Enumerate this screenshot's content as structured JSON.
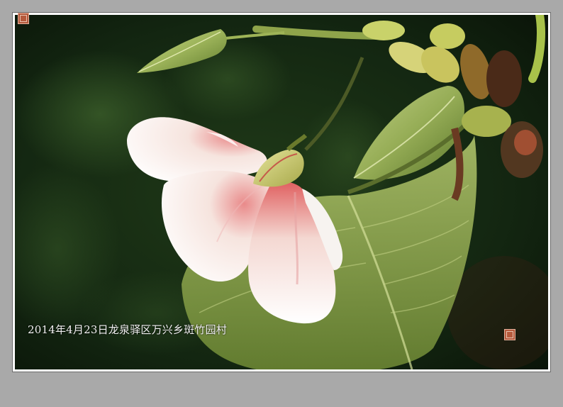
{
  "photo": {
    "caption": "2014年4月23日龙泉驿区万兴乡斑竹园村",
    "subject_icon": "white-pink-flower"
  },
  "seals": [
    {
      "name": "seal-top-left",
      "color": "#b55a3c"
    },
    {
      "name": "seal-bottom-right",
      "color": "#b55a3c"
    }
  ],
  "colors": {
    "background": "#a9a9a9",
    "border": "#ffffff",
    "accent_pink": "#e2586a",
    "leaf": "#9aae5a"
  }
}
